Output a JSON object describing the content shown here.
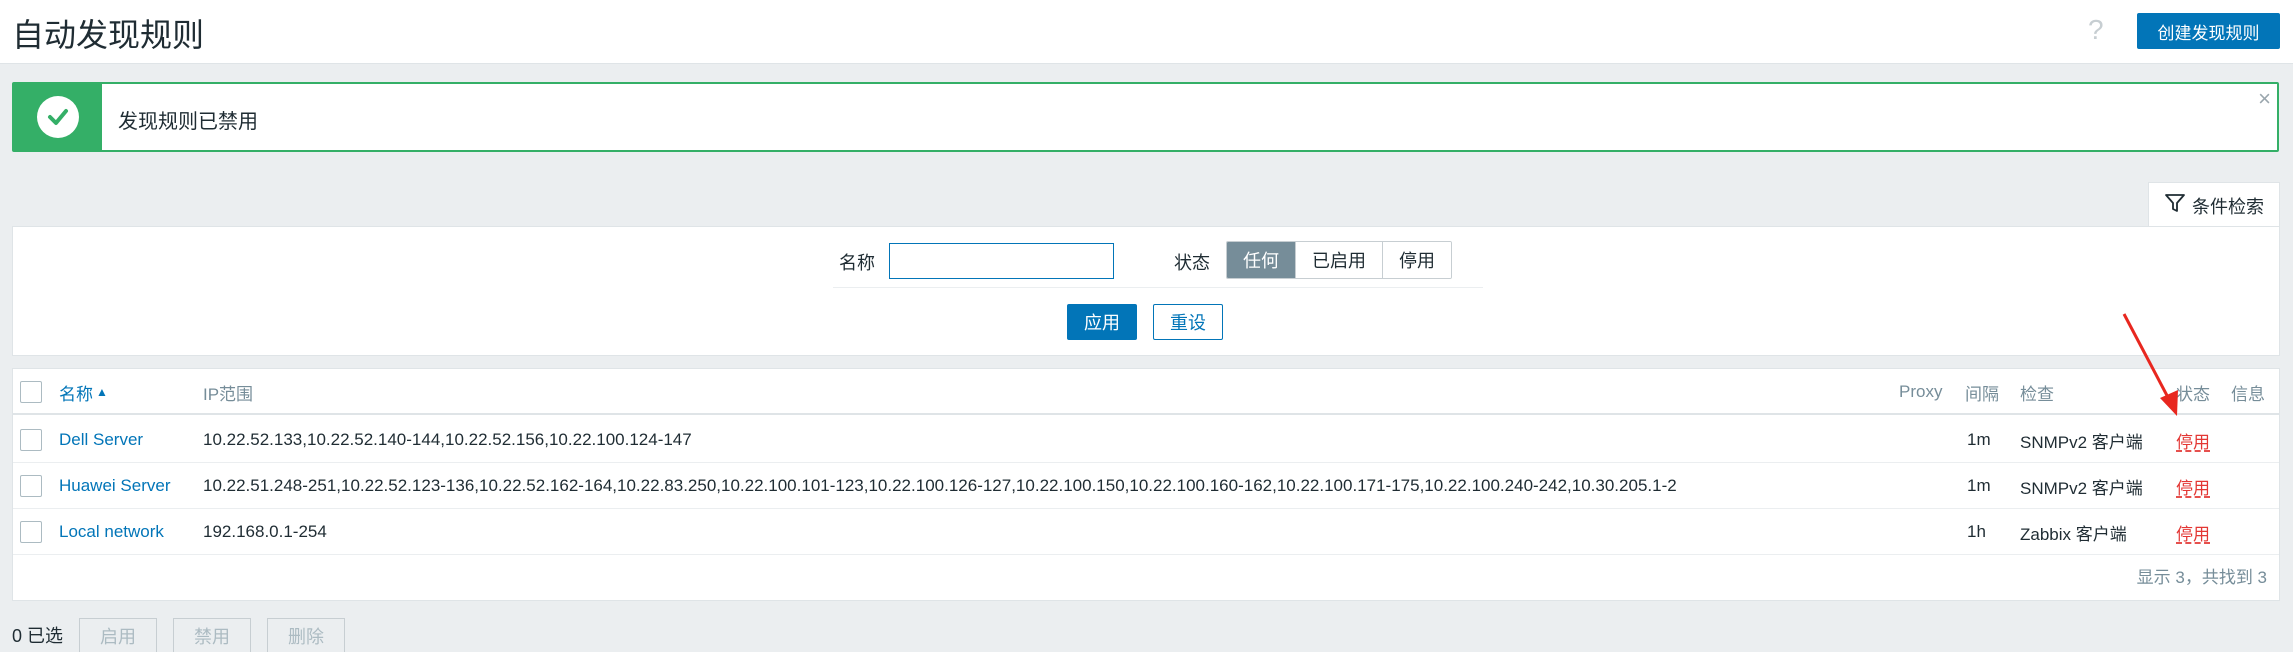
{
  "header": {
    "title": "自动发现规则",
    "help": "?",
    "create_button": "创建发现规则"
  },
  "message": {
    "text": "发现规则已禁用",
    "close": "×"
  },
  "filter": {
    "tab_label": "条件检索",
    "name_label": "名称",
    "name_value": "",
    "status_label": "状态",
    "status_options": [
      "任何",
      "已启用",
      "停用"
    ],
    "status_selected": "任何",
    "apply": "应用",
    "reset": "重设"
  },
  "table": {
    "headers": {
      "name": "名称",
      "sort_indicator": "▲",
      "ip_range": "IP范围",
      "proxy": "Proxy",
      "interval": "间隔",
      "checks": "检查",
      "status": "状态",
      "info": "信息"
    },
    "rows": [
      {
        "name": "Dell Server",
        "ip_range": "10.22.52.133,10.22.52.140-144,10.22.52.156,10.22.100.124-147",
        "proxy": "",
        "interval": "1m",
        "checks": "SNMPv2 客户端",
        "status": "停用"
      },
      {
        "name": "Huawei Server",
        "ip_range": "10.22.51.248-251,10.22.52.123-136,10.22.52.162-164,10.22.83.250,10.22.100.101-123,10.22.100.126-127,10.22.100.150,10.22.100.160-162,10.22.100.171-175,10.22.100.240-242,10.30.205.1-2",
        "proxy": "",
        "interval": "1m",
        "checks": "SNMPv2 客户端",
        "status": "停用"
      },
      {
        "name": "Local network",
        "ip_range": "192.168.0.1-254",
        "proxy": "",
        "interval": "1h",
        "checks": "Zabbix 客户端",
        "status": "停用"
      }
    ],
    "footer": "显示 3，共找到 3"
  },
  "actions": {
    "selected": "0 已选",
    "enable": "启用",
    "disable": "禁用",
    "delete": "删除"
  },
  "colors": {
    "accent": "#0275b8",
    "success": "#34af67",
    "disabled_status": "#e33734",
    "annotation_arrow": "#e8271f"
  }
}
